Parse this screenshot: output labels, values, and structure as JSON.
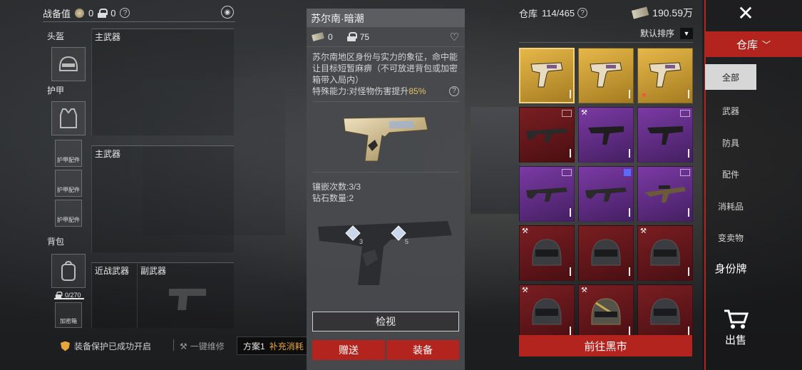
{
  "loadout": {
    "title": "战备值",
    "coin_value": "0",
    "lock_value": "0",
    "help": "?",
    "helmet_label": "头盔",
    "armor_label": "护甲",
    "backpack_label": "背包",
    "primary_weapon_1": "主武器",
    "primary_weapon_2": "主武器",
    "melee_label": "近战武器",
    "secondary_label": "副武器",
    "armor_parts": [
      "护甲配件",
      "护甲配件",
      "护甲配件"
    ],
    "capacity": "0/270",
    "encrypted_box": "加密箱",
    "protection_text": "装备保护已成功开启",
    "repair_text": "一键维修",
    "plan_label": "方案1",
    "supply_label": "补充消耗"
  },
  "detail": {
    "title": "苏尔南·暗潮",
    "stat_bill": "0",
    "stat_lock": "75",
    "description": "苏尔南地区身份与实力的象征，命中能让目标短暂麻痹（不可放进背包或加密箱带入局内）",
    "ability_prefix": "特殊能力:对怪物伤害提升",
    "ability_value": "85%",
    "inlay_count": "镶嵌次数:3/3",
    "diamond_count": "钻石数量:2",
    "gem_a": "3",
    "gem_b": "5",
    "view_btn": "检视",
    "gift_btn": "赠送",
    "equip_btn": "装备"
  },
  "inventory": {
    "label": "仓库",
    "count": "114/465",
    "money": "190.59万",
    "sort_label": "默认排序",
    "cells": [
      {
        "rarity": "gold",
        "kind": "pistol",
        "selected": true
      },
      {
        "rarity": "gold",
        "kind": "pistol",
        "selected": false
      },
      {
        "rarity": "gold",
        "kind": "pistol",
        "selected": false,
        "heart": true
      },
      {
        "rarity": "red",
        "kind": "rifle",
        "corner": "grid"
      },
      {
        "rarity": "purple",
        "kind": "smg",
        "corner": "hammer"
      },
      {
        "rarity": "purple",
        "kind": "smg",
        "corner": "box"
      },
      {
        "rarity": "purple",
        "kind": "rifle",
        "corner": "grid"
      },
      {
        "rarity": "purple",
        "kind": "rifle",
        "corner": "blue"
      },
      {
        "rarity": "purple",
        "kind": "sniper",
        "corner": "box"
      },
      {
        "rarity": "red",
        "kind": "helmet",
        "corner": "hammer"
      },
      {
        "rarity": "red",
        "kind": "helmet",
        "corner": ""
      },
      {
        "rarity": "red",
        "kind": "helmet",
        "corner": "hammer"
      },
      {
        "rarity": "red",
        "kind": "helmet",
        "corner": "hammer"
      },
      {
        "rarity": "red",
        "kind": "helmet-gold",
        "corner": "hammer"
      },
      {
        "rarity": "red",
        "kind": "helmet",
        "corner": ""
      }
    ],
    "black_market_btn": "前往黑市"
  },
  "sidebar": {
    "header": "仓库",
    "items": [
      "全部",
      "武器",
      "防具",
      "配件",
      "消耗品",
      "变卖物",
      "身份牌"
    ],
    "sell": "出售"
  },
  "colors": {
    "accent_red": "#b3241e",
    "gold": "#e6b84a",
    "purple": "#7b3aa4",
    "highlight": "#e8c26b"
  }
}
